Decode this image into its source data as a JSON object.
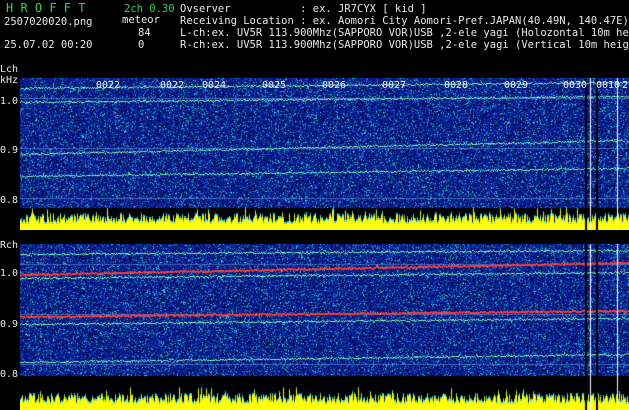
{
  "header": {
    "app_title": "H R O F F T",
    "mode": "2ch 0.30",
    "filename": "2507020020.png",
    "type_label": "meteor",
    "count_l": "84",
    "count_r": "0",
    "datetime": "25.07.02 00:20",
    "observer": "Ovserver           : ex. JR7CYX [ kid ]",
    "location": "Receiving Location : ex. Aomori City Aomori-Pref.JAPAN(40.49N, 140.47E)",
    "l_channel": "L-ch:ex. UV5R 113.900Mhz(SAPPORO VOR)USB ,2-ele yagi (Holozontal 10m height)",
    "r_channel": "R-ch:ex. UV5R 113.900Mhz(SAPPORO VOR)USB ,2-ele yagi (Vertical 10m height)"
  },
  "lch": {
    "label": "Lch",
    "unit": "kHz",
    "ticks": [
      "1.0",
      "0.9",
      "0.8"
    ]
  },
  "rch": {
    "label": "Rch",
    "ticks": [
      "1.0",
      "0.9",
      "0.8"
    ]
  },
  "time_markers": [
    "0022",
    "0022",
    "0024",
    "0025",
    "0026",
    "0027",
    "0028",
    "0029",
    "0030",
    "0010",
    "2"
  ],
  "colors": {
    "background": "#000000",
    "spectrogram_base": "#0a1a8a",
    "noise_cyan": "#38d8d0",
    "signal_red": "#ff3030",
    "amplitude_yellow": "#ffff00",
    "text_green": "#33d24a"
  }
}
